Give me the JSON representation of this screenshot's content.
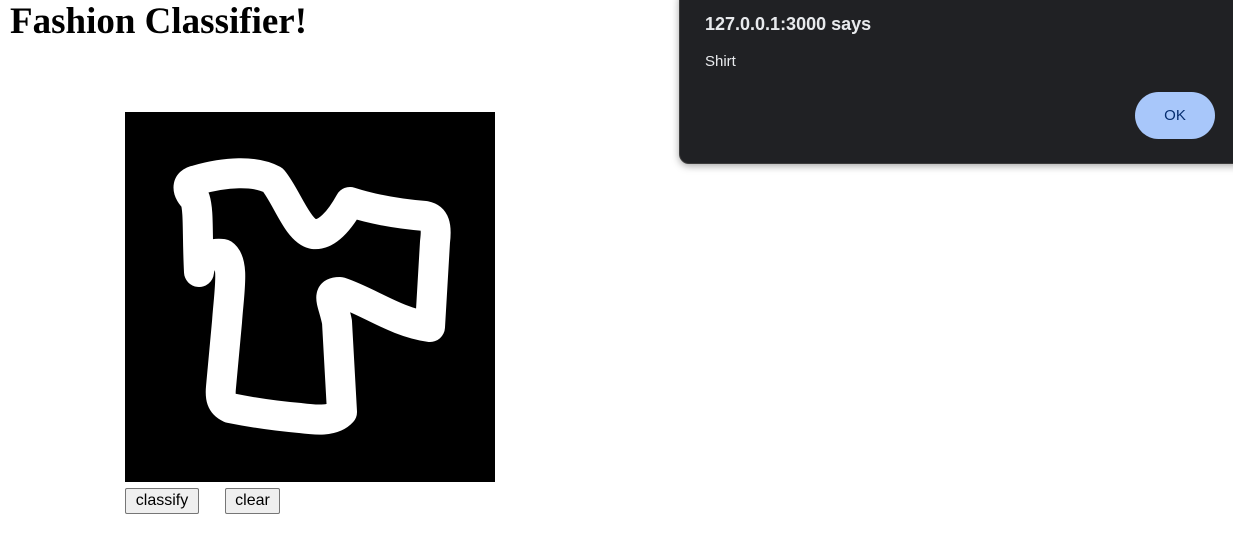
{
  "page": {
    "title": "Fashion Classifier!"
  },
  "canvas": {
    "background": "#000000",
    "stroke_color": "#ffffff"
  },
  "buttons": {
    "classify_label": "classify",
    "clear_label": "clear"
  },
  "alert": {
    "origin": "127.0.0.1:3000 says",
    "message": "Shirt",
    "ok_label": "OK",
    "background": "#202124",
    "ok_color": "#a8c7fa"
  }
}
